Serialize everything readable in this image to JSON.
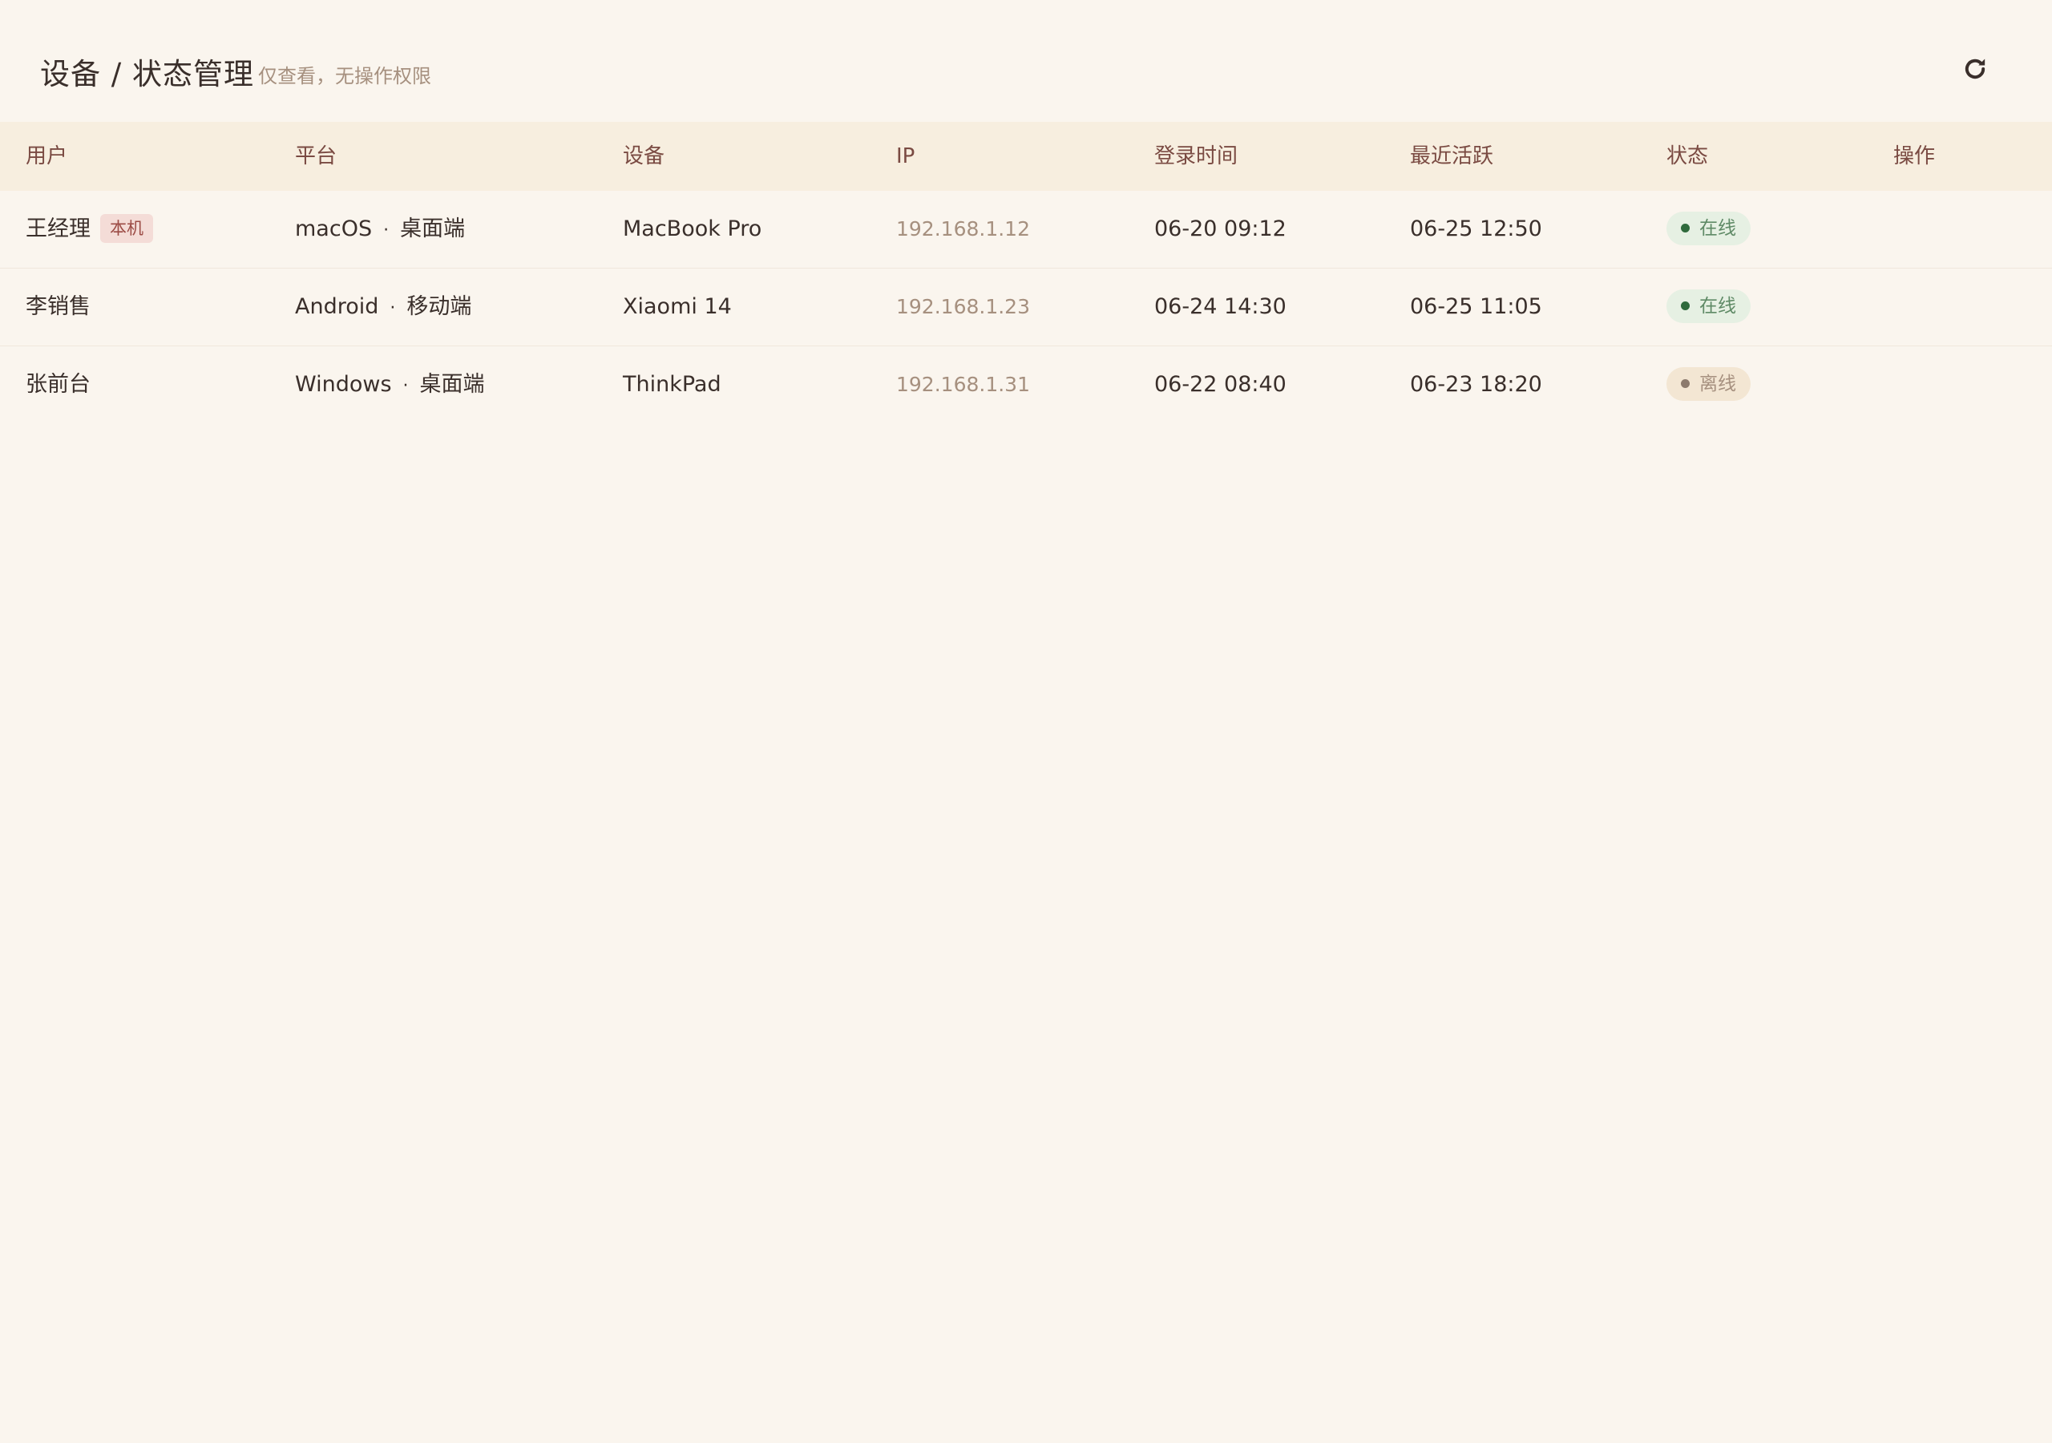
{
  "header": {
    "title": "设备 / 状态管理",
    "subtitle": "仅查看，无操作权限",
    "refresh_icon": "refresh-icon"
  },
  "table": {
    "columns": [
      "用户",
      "平台",
      "设备",
      "IP",
      "登录时间",
      "最近活跃",
      "状态",
      "操作"
    ],
    "rows": [
      {
        "user": "王经理",
        "tag": "本机",
        "os": "macOS",
        "sep": "·",
        "client": "桌面端",
        "device": "MacBook Pro",
        "ip": "192.168.1.12",
        "login": "06-20 09:12",
        "active": "06-25 12:50",
        "status": "在线"
      },
      {
        "user": "李销售",
        "tag": "",
        "os": "Android",
        "sep": "·",
        "client": "移动端",
        "device": "Xiaomi 14",
        "ip": "192.168.1.23",
        "login": "06-24 14:30",
        "active": "06-25 11:05",
        "status": "在线"
      },
      {
        "user": "张前台",
        "tag": "",
        "os": "Windows",
        "sep": "·",
        "client": "桌面端",
        "device": "ThinkPad",
        "ip": "192.168.1.31",
        "login": "06-22 08:40",
        "active": "06-23 18:20",
        "status": "离线"
      }
    ]
  },
  "colors": {
    "background": "#faf5ee",
    "header_row": "#f7eedf",
    "header_text": "#7a4a42",
    "online": "#2f6a3c",
    "offline": "#8c7a6d",
    "self_tag": "#9c4b45"
  }
}
